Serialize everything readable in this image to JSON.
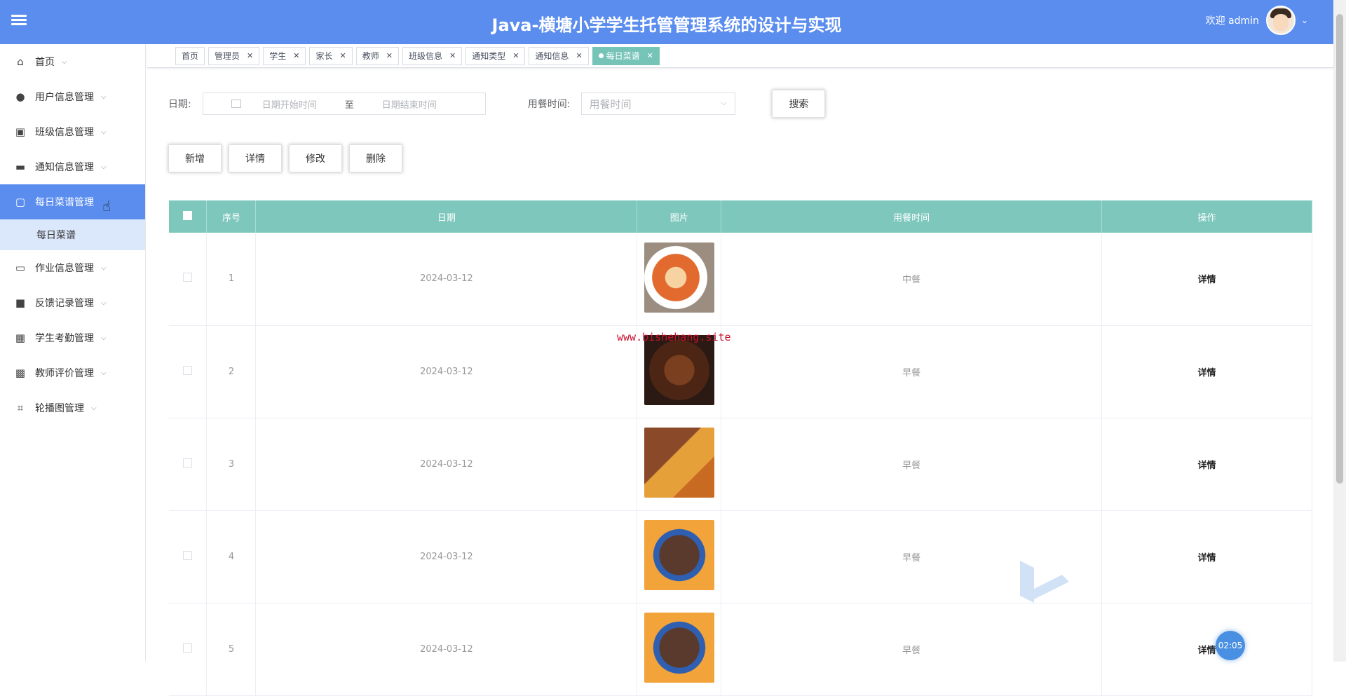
{
  "header": {
    "title": "Java-横塘小学学生托管管理系统的设计与实现",
    "welcome": "欢迎 admin"
  },
  "sidebar": {
    "items": [
      {
        "label": "首页",
        "icon": "home-icon"
      },
      {
        "label": "用户信息管理",
        "icon": "user-icon"
      },
      {
        "label": "班级信息管理",
        "icon": "class-icon"
      },
      {
        "label": "通知信息管理",
        "icon": "notice-icon"
      },
      {
        "label": "每日菜谱管理",
        "icon": "menu-icon",
        "active": true
      },
      {
        "label": "作业信息管理",
        "icon": "homework-icon"
      },
      {
        "label": "反馈记录管理",
        "icon": "feedback-icon"
      },
      {
        "label": "学生考勤管理",
        "icon": "attendance-icon"
      },
      {
        "label": "教师评价管理",
        "icon": "evaluation-icon"
      },
      {
        "label": "轮播图管理",
        "icon": "carousel-icon"
      }
    ],
    "submenu": {
      "label": "每日菜谱"
    }
  },
  "tabs": [
    "首页",
    "管理员",
    "学生",
    "家长",
    "教师",
    "班级信息",
    "通知类型",
    "通知信息",
    "每日菜谱"
  ],
  "search": {
    "date_label": "日期:",
    "date_start_placeholder": "日期开始时间",
    "date_sep": "至",
    "date_end_placeholder": "日期结束时间",
    "meal_label": "用餐时间:",
    "meal_placeholder": "用餐时间",
    "search_button": "搜索"
  },
  "actions": {
    "add": "新增",
    "detail": "详情",
    "edit": "修改",
    "delete": "删除"
  },
  "table": {
    "headers": {
      "index": "序号",
      "date": "日期",
      "image": "图片",
      "meal_time": "用餐时间",
      "operation": "操作"
    },
    "rows": [
      {
        "index": "1",
        "date": "2024-03-12",
        "meal_time": "中餐",
        "op": "详情"
      },
      {
        "index": "2",
        "date": "2024-03-12",
        "meal_time": "早餐",
        "op": "详情"
      },
      {
        "index": "3",
        "date": "2024-03-12",
        "meal_time": "早餐",
        "op": "详情"
      },
      {
        "index": "4",
        "date": "2024-03-12",
        "meal_time": "早餐",
        "op": "详情"
      },
      {
        "index": "5",
        "date": "2024-03-12",
        "meal_time": "早餐",
        "op": "详情"
      }
    ]
  },
  "watermark": "www.bishehang.site",
  "timer": "02:05",
  "colors": {
    "header": "#5b8def",
    "table_header": "#7ec7bc",
    "active_tag": "#76c3b8"
  }
}
